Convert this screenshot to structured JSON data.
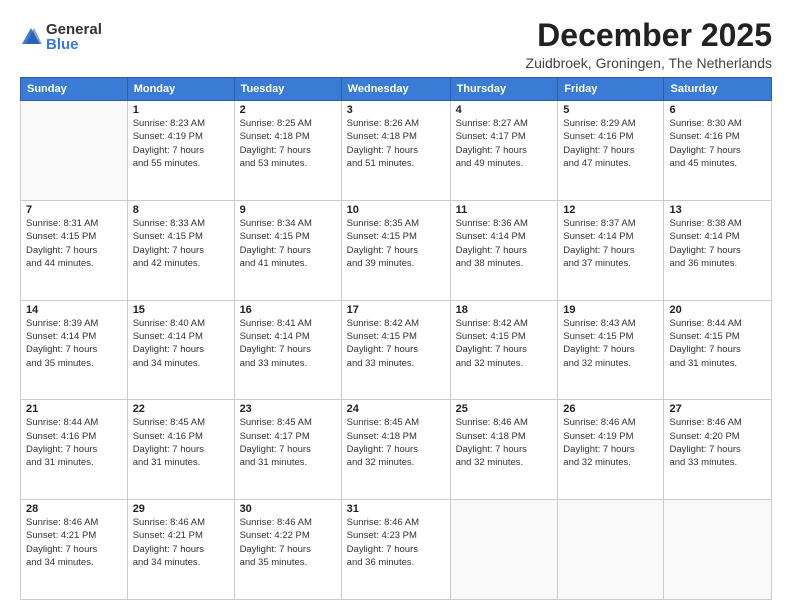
{
  "logo": {
    "general": "General",
    "blue": "Blue"
  },
  "title": "December 2025",
  "subtitle": "Zuidbroek, Groningen, The Netherlands",
  "days_header": [
    "Sunday",
    "Monday",
    "Tuesday",
    "Wednesday",
    "Thursday",
    "Friday",
    "Saturday"
  ],
  "weeks": [
    [
      {
        "day": "",
        "info": ""
      },
      {
        "day": "1",
        "info": "Sunrise: 8:23 AM\nSunset: 4:19 PM\nDaylight: 7 hours\nand 55 minutes."
      },
      {
        "day": "2",
        "info": "Sunrise: 8:25 AM\nSunset: 4:18 PM\nDaylight: 7 hours\nand 53 minutes."
      },
      {
        "day": "3",
        "info": "Sunrise: 8:26 AM\nSunset: 4:18 PM\nDaylight: 7 hours\nand 51 minutes."
      },
      {
        "day": "4",
        "info": "Sunrise: 8:27 AM\nSunset: 4:17 PM\nDaylight: 7 hours\nand 49 minutes."
      },
      {
        "day": "5",
        "info": "Sunrise: 8:29 AM\nSunset: 4:16 PM\nDaylight: 7 hours\nand 47 minutes."
      },
      {
        "day": "6",
        "info": "Sunrise: 8:30 AM\nSunset: 4:16 PM\nDaylight: 7 hours\nand 45 minutes."
      }
    ],
    [
      {
        "day": "7",
        "info": "Sunrise: 8:31 AM\nSunset: 4:15 PM\nDaylight: 7 hours\nand 44 minutes."
      },
      {
        "day": "8",
        "info": "Sunrise: 8:33 AM\nSunset: 4:15 PM\nDaylight: 7 hours\nand 42 minutes."
      },
      {
        "day": "9",
        "info": "Sunrise: 8:34 AM\nSunset: 4:15 PM\nDaylight: 7 hours\nand 41 minutes."
      },
      {
        "day": "10",
        "info": "Sunrise: 8:35 AM\nSunset: 4:15 PM\nDaylight: 7 hours\nand 39 minutes."
      },
      {
        "day": "11",
        "info": "Sunrise: 8:36 AM\nSunset: 4:14 PM\nDaylight: 7 hours\nand 38 minutes."
      },
      {
        "day": "12",
        "info": "Sunrise: 8:37 AM\nSunset: 4:14 PM\nDaylight: 7 hours\nand 37 minutes."
      },
      {
        "day": "13",
        "info": "Sunrise: 8:38 AM\nSunset: 4:14 PM\nDaylight: 7 hours\nand 36 minutes."
      }
    ],
    [
      {
        "day": "14",
        "info": "Sunrise: 8:39 AM\nSunset: 4:14 PM\nDaylight: 7 hours\nand 35 minutes."
      },
      {
        "day": "15",
        "info": "Sunrise: 8:40 AM\nSunset: 4:14 PM\nDaylight: 7 hours\nand 34 minutes."
      },
      {
        "day": "16",
        "info": "Sunrise: 8:41 AM\nSunset: 4:14 PM\nDaylight: 7 hours\nand 33 minutes."
      },
      {
        "day": "17",
        "info": "Sunrise: 8:42 AM\nSunset: 4:15 PM\nDaylight: 7 hours\nand 33 minutes."
      },
      {
        "day": "18",
        "info": "Sunrise: 8:42 AM\nSunset: 4:15 PM\nDaylight: 7 hours\nand 32 minutes."
      },
      {
        "day": "19",
        "info": "Sunrise: 8:43 AM\nSunset: 4:15 PM\nDaylight: 7 hours\nand 32 minutes."
      },
      {
        "day": "20",
        "info": "Sunrise: 8:44 AM\nSunset: 4:15 PM\nDaylight: 7 hours\nand 31 minutes."
      }
    ],
    [
      {
        "day": "21",
        "info": "Sunrise: 8:44 AM\nSunset: 4:16 PM\nDaylight: 7 hours\nand 31 minutes."
      },
      {
        "day": "22",
        "info": "Sunrise: 8:45 AM\nSunset: 4:16 PM\nDaylight: 7 hours\nand 31 minutes."
      },
      {
        "day": "23",
        "info": "Sunrise: 8:45 AM\nSunset: 4:17 PM\nDaylight: 7 hours\nand 31 minutes."
      },
      {
        "day": "24",
        "info": "Sunrise: 8:45 AM\nSunset: 4:18 PM\nDaylight: 7 hours\nand 32 minutes."
      },
      {
        "day": "25",
        "info": "Sunrise: 8:46 AM\nSunset: 4:18 PM\nDaylight: 7 hours\nand 32 minutes."
      },
      {
        "day": "26",
        "info": "Sunrise: 8:46 AM\nSunset: 4:19 PM\nDaylight: 7 hours\nand 32 minutes."
      },
      {
        "day": "27",
        "info": "Sunrise: 8:46 AM\nSunset: 4:20 PM\nDaylight: 7 hours\nand 33 minutes."
      }
    ],
    [
      {
        "day": "28",
        "info": "Sunrise: 8:46 AM\nSunset: 4:21 PM\nDaylight: 7 hours\nand 34 minutes."
      },
      {
        "day": "29",
        "info": "Sunrise: 8:46 AM\nSunset: 4:21 PM\nDaylight: 7 hours\nand 34 minutes."
      },
      {
        "day": "30",
        "info": "Sunrise: 8:46 AM\nSunset: 4:22 PM\nDaylight: 7 hours\nand 35 minutes."
      },
      {
        "day": "31",
        "info": "Sunrise: 8:46 AM\nSunset: 4:23 PM\nDaylight: 7 hours\nand 36 minutes."
      },
      {
        "day": "",
        "info": ""
      },
      {
        "day": "",
        "info": ""
      },
      {
        "day": "",
        "info": ""
      }
    ]
  ]
}
